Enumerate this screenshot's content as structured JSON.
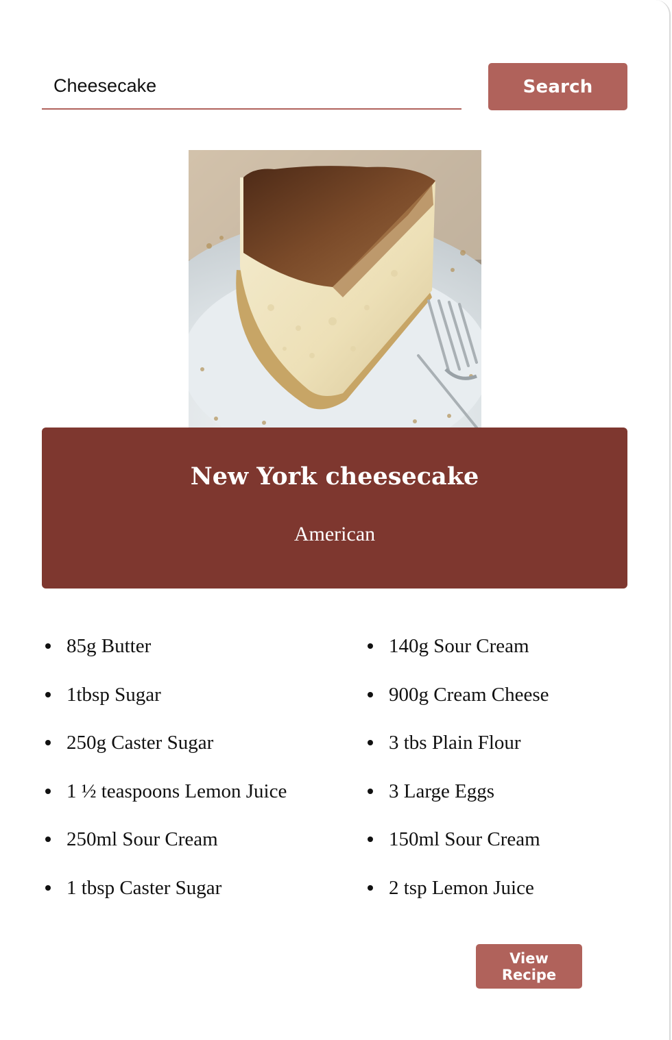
{
  "search": {
    "value": "Cheesecake",
    "placeholder": "",
    "button_label": "Search"
  },
  "recipe": {
    "image_alt": "New York cheesecake",
    "title": "New York cheesecake",
    "cuisine": "American",
    "ingredients_left": [
      "85g Butter",
      "1tbsp Sugar",
      "250g Caster Sugar",
      "1 ½ teaspoons Lemon Juice",
      "250ml Sour Cream",
      "1 tbsp Caster Sugar"
    ],
    "ingredients_right": [
      "140g Sour Cream",
      "900g Cream Cheese",
      "3 tbs Plain Flour",
      "3 Large Eggs",
      "150ml Sour Cream",
      "2 tsp Lemon Juice"
    ],
    "view_button_label": "View Recipe"
  },
  "colors": {
    "accent": "#b0625b",
    "title_box": "#7e372f",
    "background": "#ffffff",
    "text": "#111111"
  }
}
